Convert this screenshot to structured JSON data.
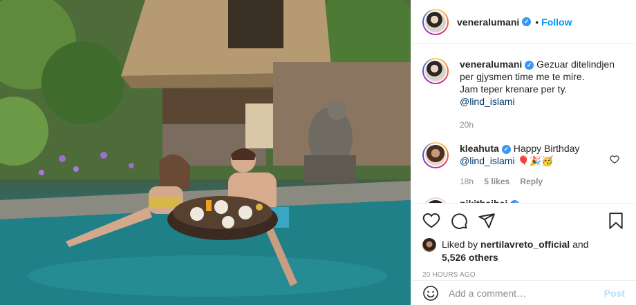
{
  "post_header": {
    "username": "veneralumani",
    "dot": "•",
    "follow_label": "Follow"
  },
  "caption": {
    "username": "veneralumani",
    "text_line1": "Gezuar ditelindjen per gjysmen time me te mire.",
    "text_line2": "Jam teper krenare per ty.",
    "mention": "@lind_islami",
    "time": "20h"
  },
  "comments": [
    {
      "username": "kleahuta",
      "text": "Happy Birthday",
      "mention": "@lind_islami",
      "emojis": "🎈🎉🥳",
      "time": "18h",
      "likes": "5 likes",
      "reply": "Reply"
    },
    {
      "username": "nikithaihei",
      "text": "..."
    }
  ],
  "actions": {
    "like_icon": "heart-icon",
    "comment_icon": "comment-icon",
    "share_icon": "paper-plane-icon",
    "save_icon": "bookmark-icon"
  },
  "likes": {
    "prefix": "Liked by",
    "user": "nertilavreto_official",
    "and": "and",
    "others": "5,526 others"
  },
  "timestamp": "20 HOURS AGO",
  "add_comment": {
    "placeholder": "Add a comment…",
    "post_label": "Post"
  },
  "colors": {
    "link_blue": "#0095f6",
    "verified_blue": "#3897f0",
    "mention_blue": "#00376b",
    "muted": "#8e8e8e",
    "post_disabled": "#b2dffc"
  }
}
